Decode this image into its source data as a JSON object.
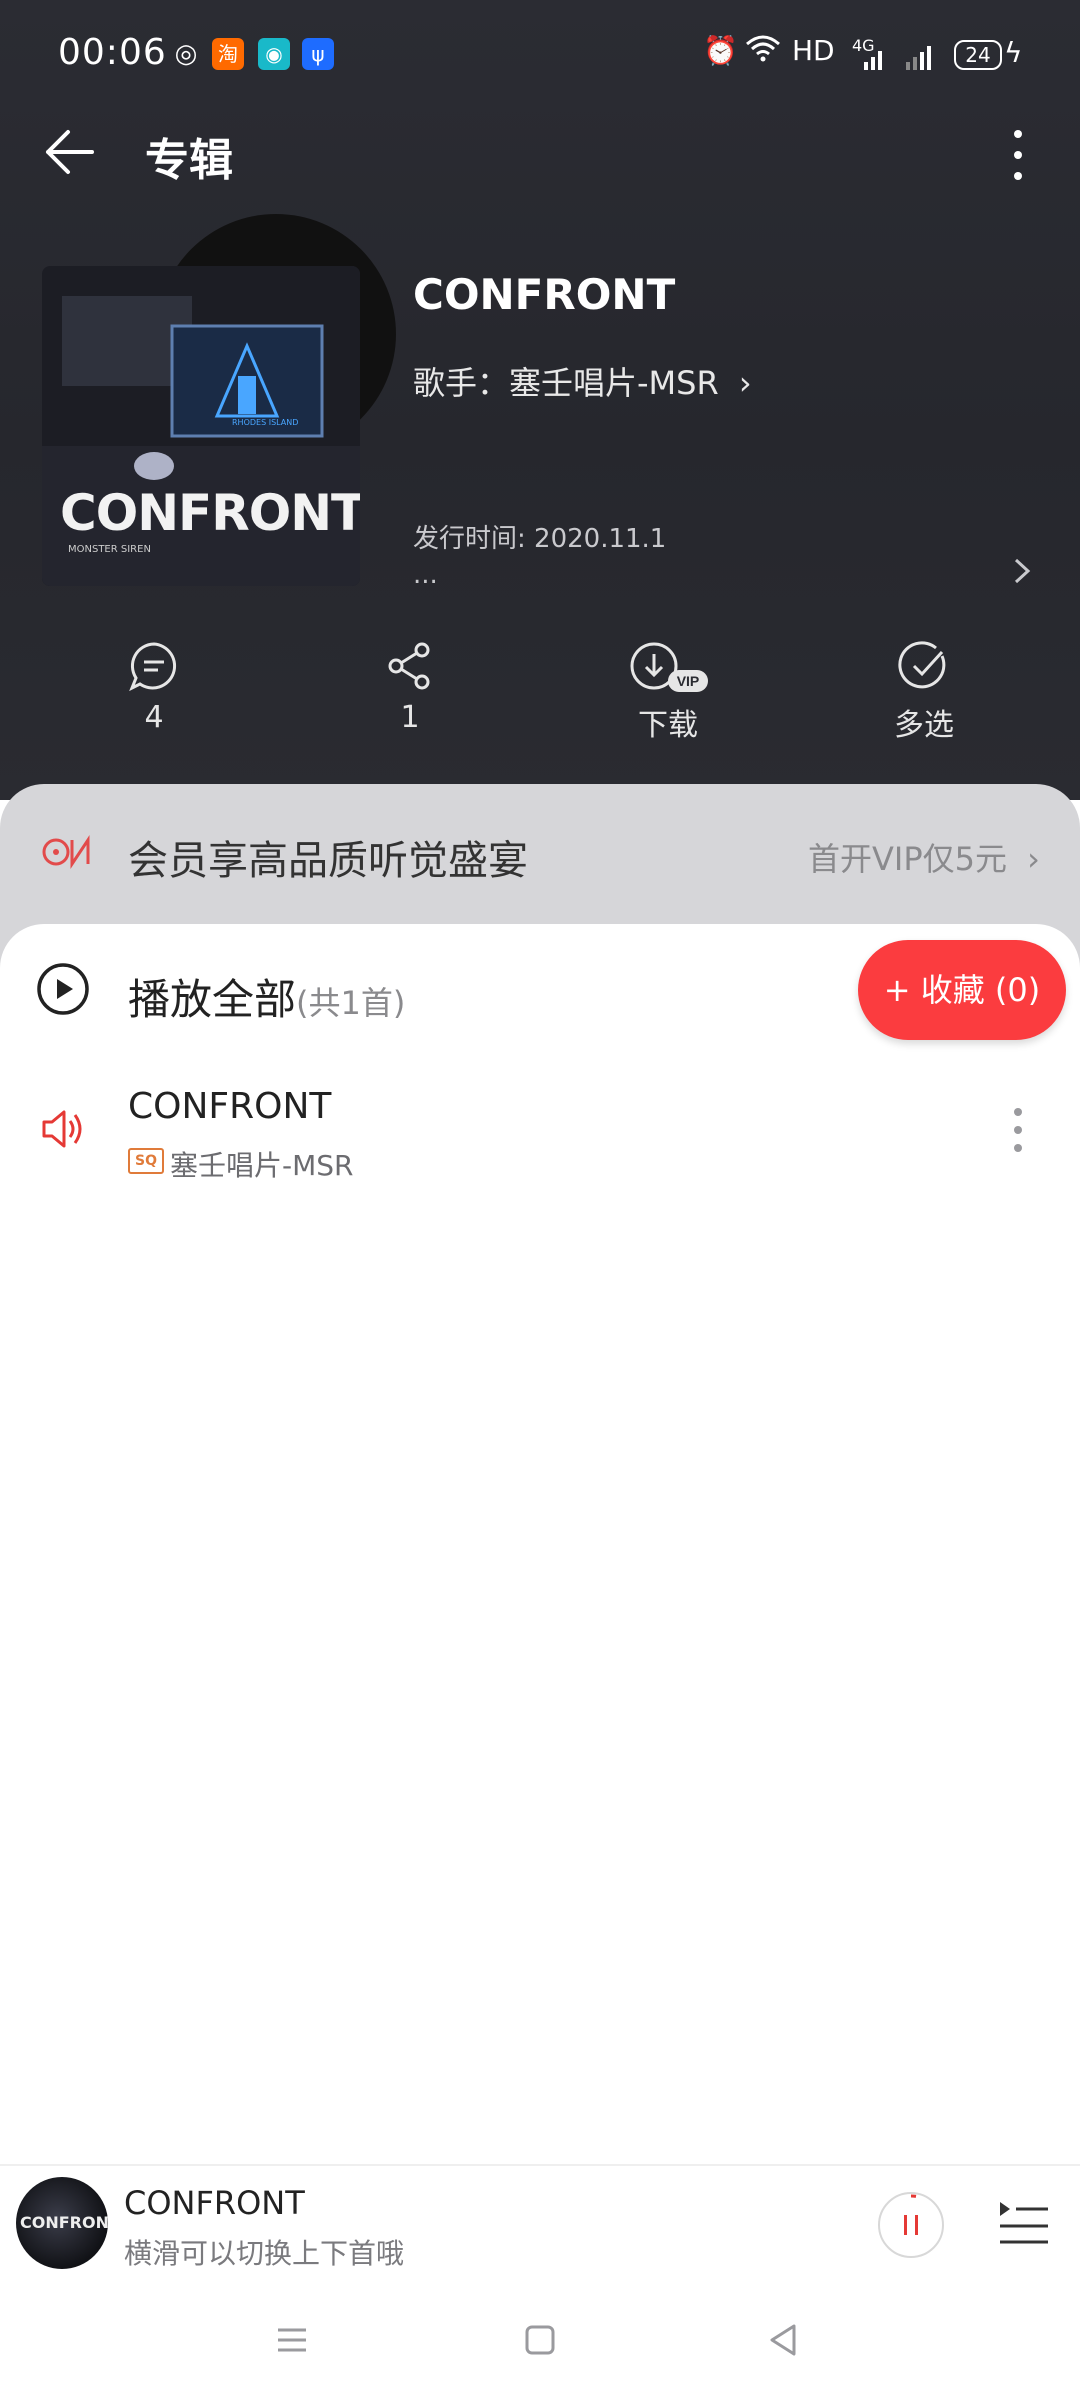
{
  "status_bar": {
    "time": "00:06",
    "network": "HD",
    "signal": "4G",
    "battery": "24"
  },
  "nav": {
    "title": "专辑"
  },
  "album": {
    "title": "CONFRONT",
    "artist": "歌手：塞壬唱片-MSR",
    "release": "发行时间: 2020.11.1",
    "more": "...",
    "cover_text": "CONFRONT",
    "cover_brand": "MONSTER SIREN",
    "cover_logo": "RHODES ISLAND"
  },
  "actions": [
    {
      "icon": "comment-icon",
      "label": "4"
    },
    {
      "icon": "share-icon",
      "label": "1"
    },
    {
      "icon": "download-vip-icon",
      "label": "下载",
      "badge": "VIP"
    },
    {
      "icon": "multi-select-icon",
      "label": "多选"
    }
  ],
  "vip": {
    "text": "会员享高品质听觉盛宴",
    "link": "首开VIP仅5元"
  },
  "list": {
    "play_all": "播放全部",
    "count": "(共1首)",
    "collect": "+ 收藏 (0)"
  },
  "songs": [
    {
      "title": "CONFRONT",
      "quality": "SQ",
      "artist": "塞壬唱片-MSR"
    }
  ],
  "player": {
    "title": "CONFRONT",
    "subtitle": "横滑可以切换上下首哦",
    "cover_text": "CONFRONT"
  },
  "colors": {
    "accent": "#fb3c3f",
    "header_bg": "#2a2b31",
    "vip_bg": "#d6d6d9"
  }
}
